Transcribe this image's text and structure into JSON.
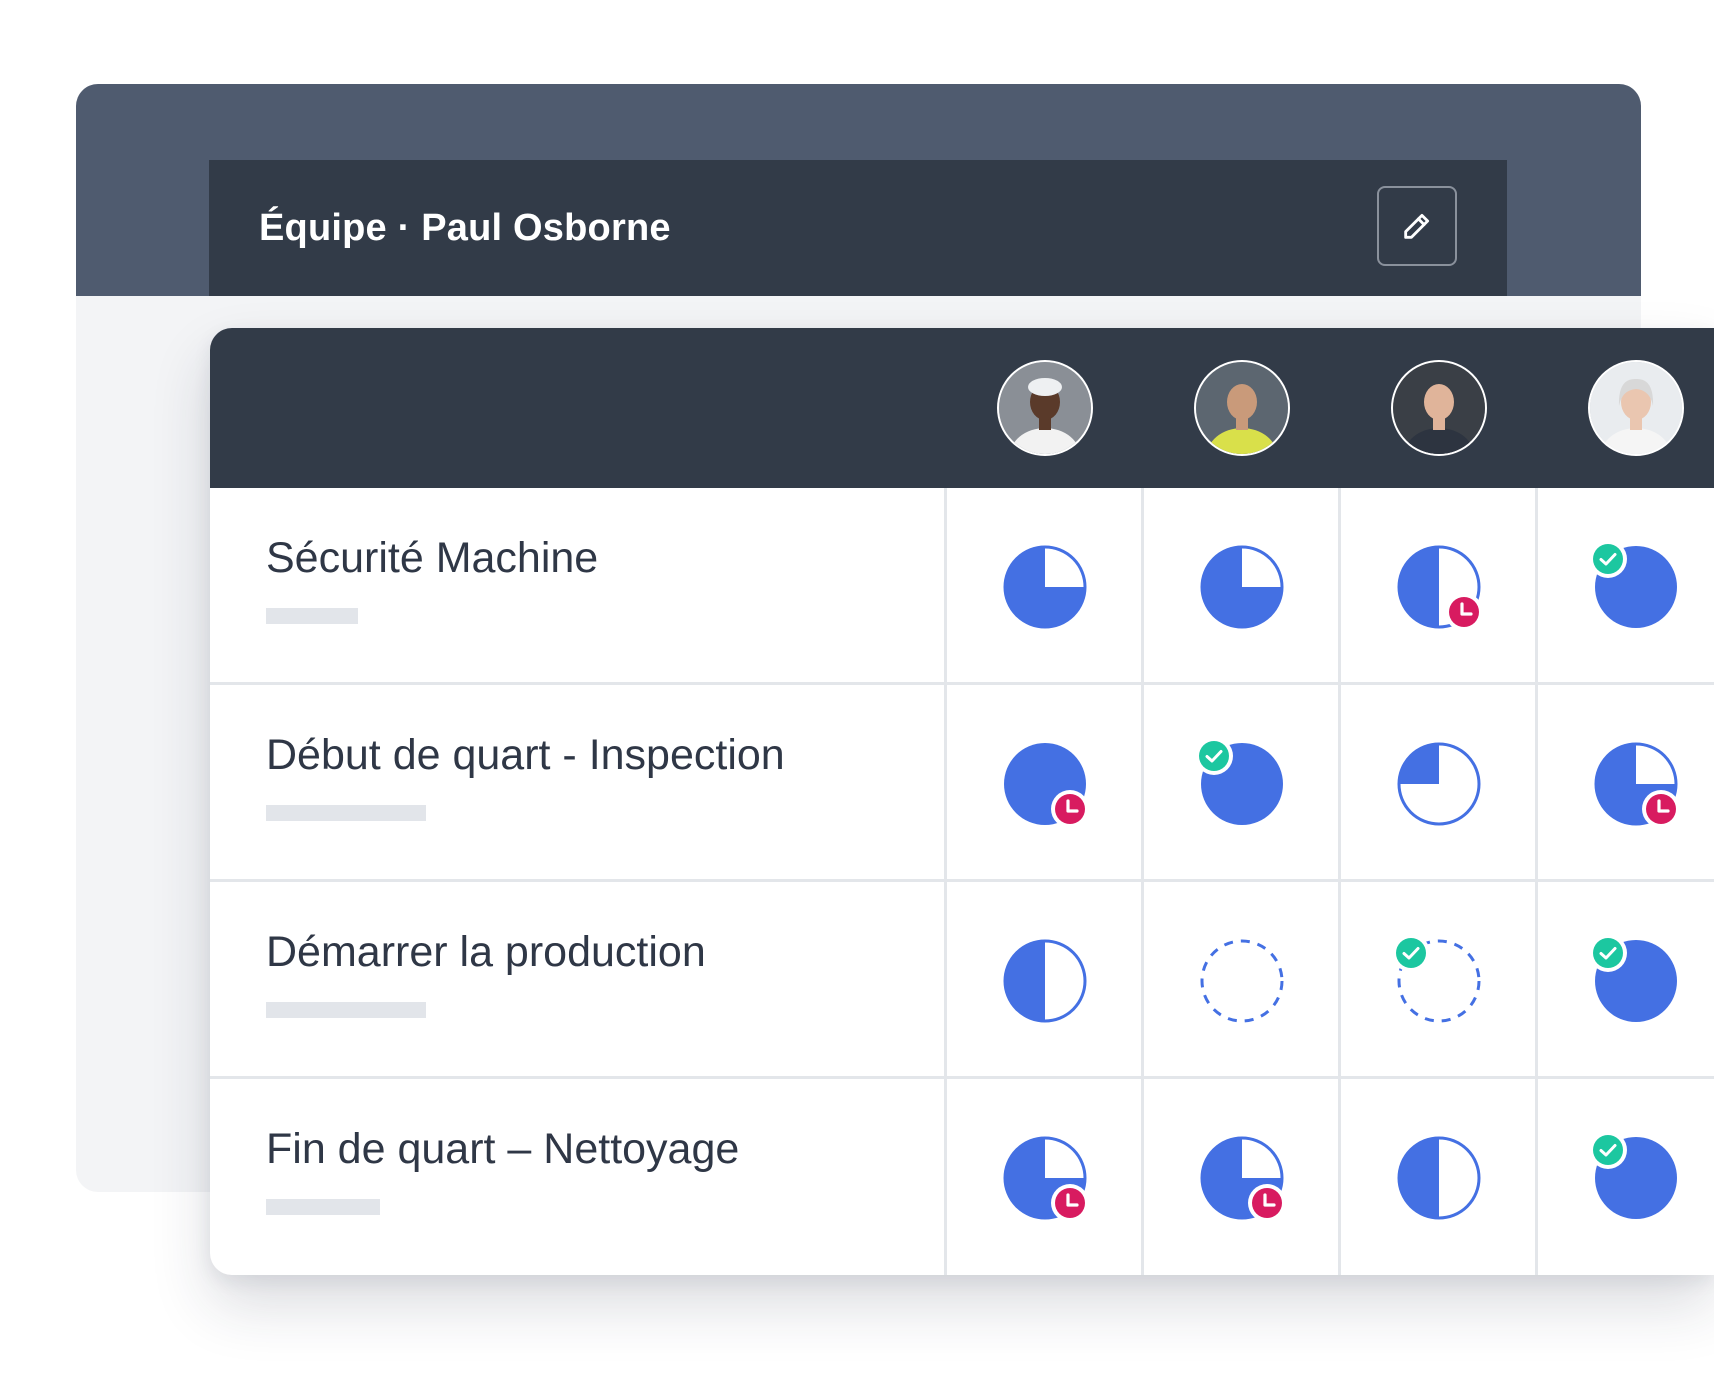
{
  "header": {
    "title": "Équipe · Paul Osborne",
    "edit_icon": "pencil-icon"
  },
  "colors": {
    "progress": "#4470e3",
    "complete": "#1cc7a0",
    "overdue": "#d81b60",
    "header_dark": "#323b48",
    "header_band": "#4f5b6f"
  },
  "team": [
    {
      "avatar": "avatar-worker-1"
    },
    {
      "avatar": "avatar-worker-2"
    },
    {
      "avatar": "avatar-worker-3"
    },
    {
      "avatar": "avatar-worker-4"
    }
  ],
  "rows": [
    {
      "label": "Sécurité Machine",
      "bar_fraction": 0.55,
      "cells": [
        {
          "progress": 0.75,
          "badge": ""
        },
        {
          "progress": 0.75,
          "badge": ""
        },
        {
          "progress": 0.5,
          "badge": "overdue"
        },
        {
          "progress": 1,
          "badge": "complete"
        }
      ]
    },
    {
      "label": "Début de quart - Inspection",
      "bar_fraction": 0.95,
      "cells": [
        {
          "progress": 1,
          "badge": "overdue"
        },
        {
          "progress": 1,
          "badge": "complete"
        },
        {
          "progress": 0.25,
          "badge": ""
        },
        {
          "progress": 0.75,
          "badge": "overdue"
        }
      ]
    },
    {
      "label": "Démarrer la production",
      "bar_fraction": 0.95,
      "cells": [
        {
          "progress": 0.5,
          "badge": ""
        },
        {
          "progress": 0,
          "badge": ""
        },
        {
          "progress": 0,
          "badge": "complete"
        },
        {
          "progress": 1,
          "badge": "complete"
        }
      ]
    },
    {
      "label": "Fin de quart – Nettoyage",
      "bar_fraction": 0.68,
      "cells": [
        {
          "progress": 0.75,
          "badge": "overdue"
        },
        {
          "progress": 0.75,
          "badge": "overdue"
        },
        {
          "progress": 0.5,
          "badge": ""
        },
        {
          "progress": 1,
          "badge": "complete"
        }
      ]
    }
  ]
}
